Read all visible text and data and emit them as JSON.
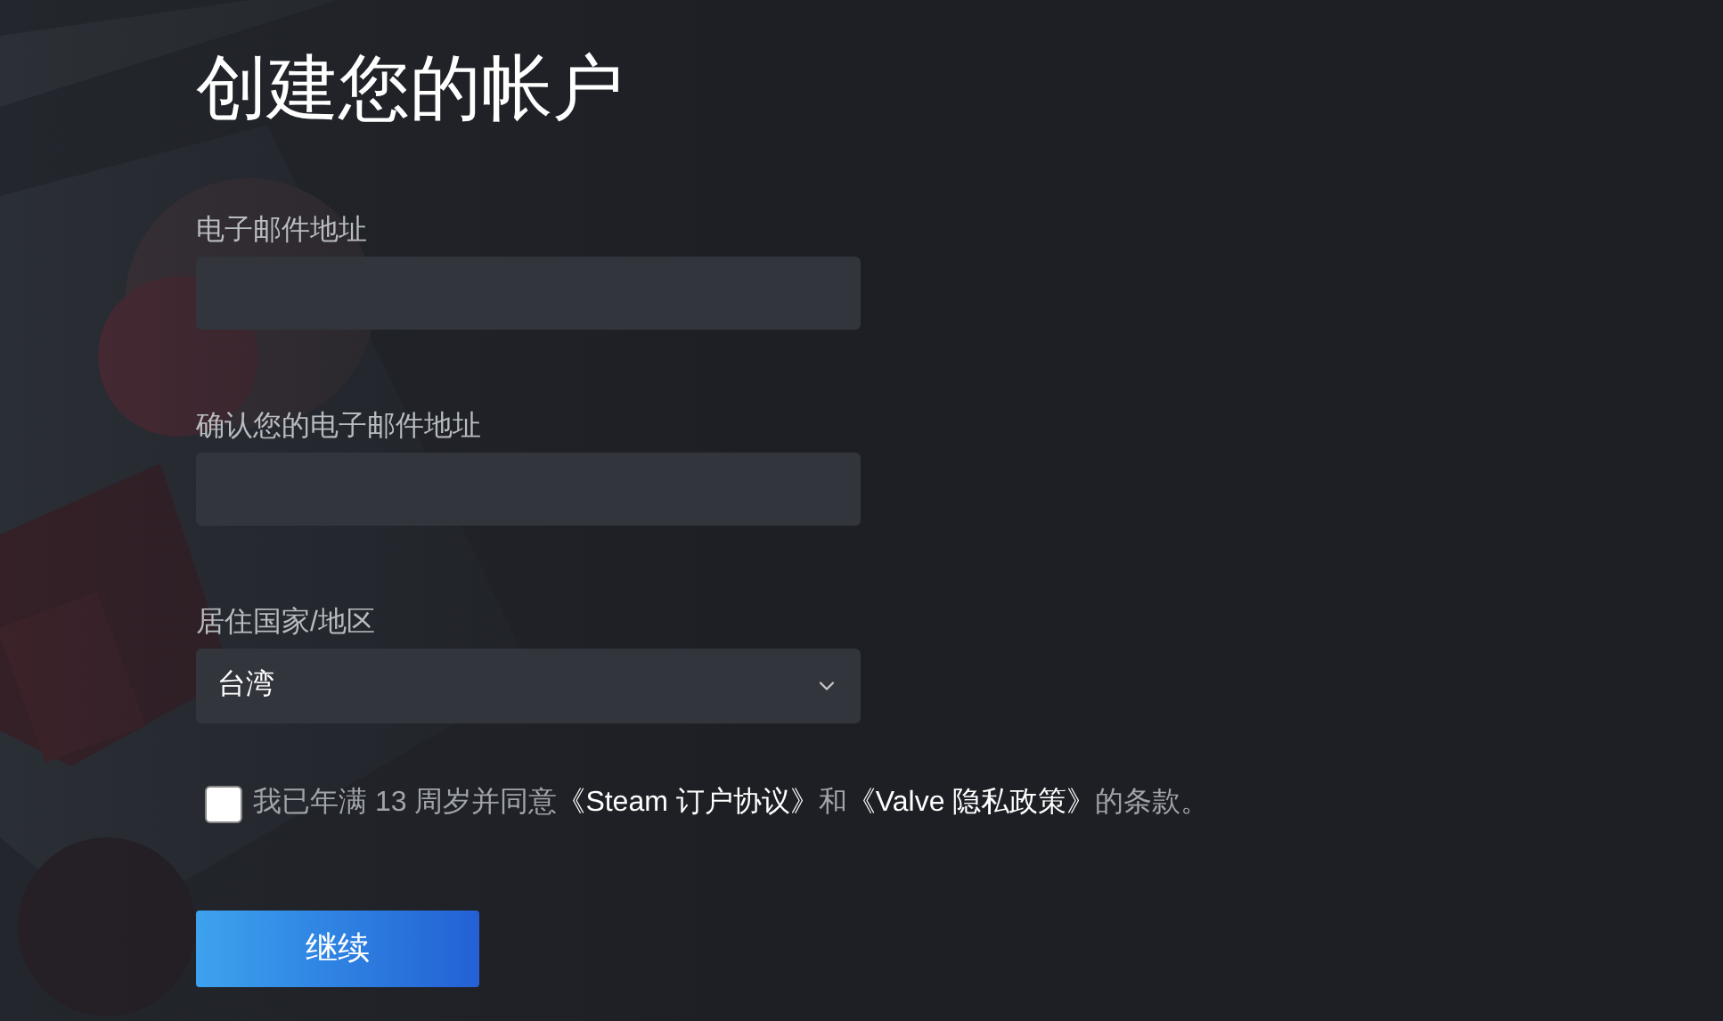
{
  "title": "创建您的帐户",
  "fields": [
    {
      "kind": "input",
      "label": "电子邮件地址"
    },
    {
      "kind": "input",
      "label": "确认您的电子邮件地址"
    },
    {
      "kind": "select",
      "label": "居住国家/地区",
      "value": "台湾"
    }
  ],
  "agreement": {
    "checked": false,
    "parts": [
      {
        "kind": "text",
        "text": "我已年满 13 周岁并同意"
      },
      {
        "kind": "link",
        "text": "《Steam 订户协议》"
      },
      {
        "kind": "text",
        "text": "和"
      },
      {
        "kind": "link",
        "text": "《Valve 隐私政策》"
      },
      {
        "kind": "text",
        "text": "的条款。"
      }
    ]
  },
  "button": "继续"
}
